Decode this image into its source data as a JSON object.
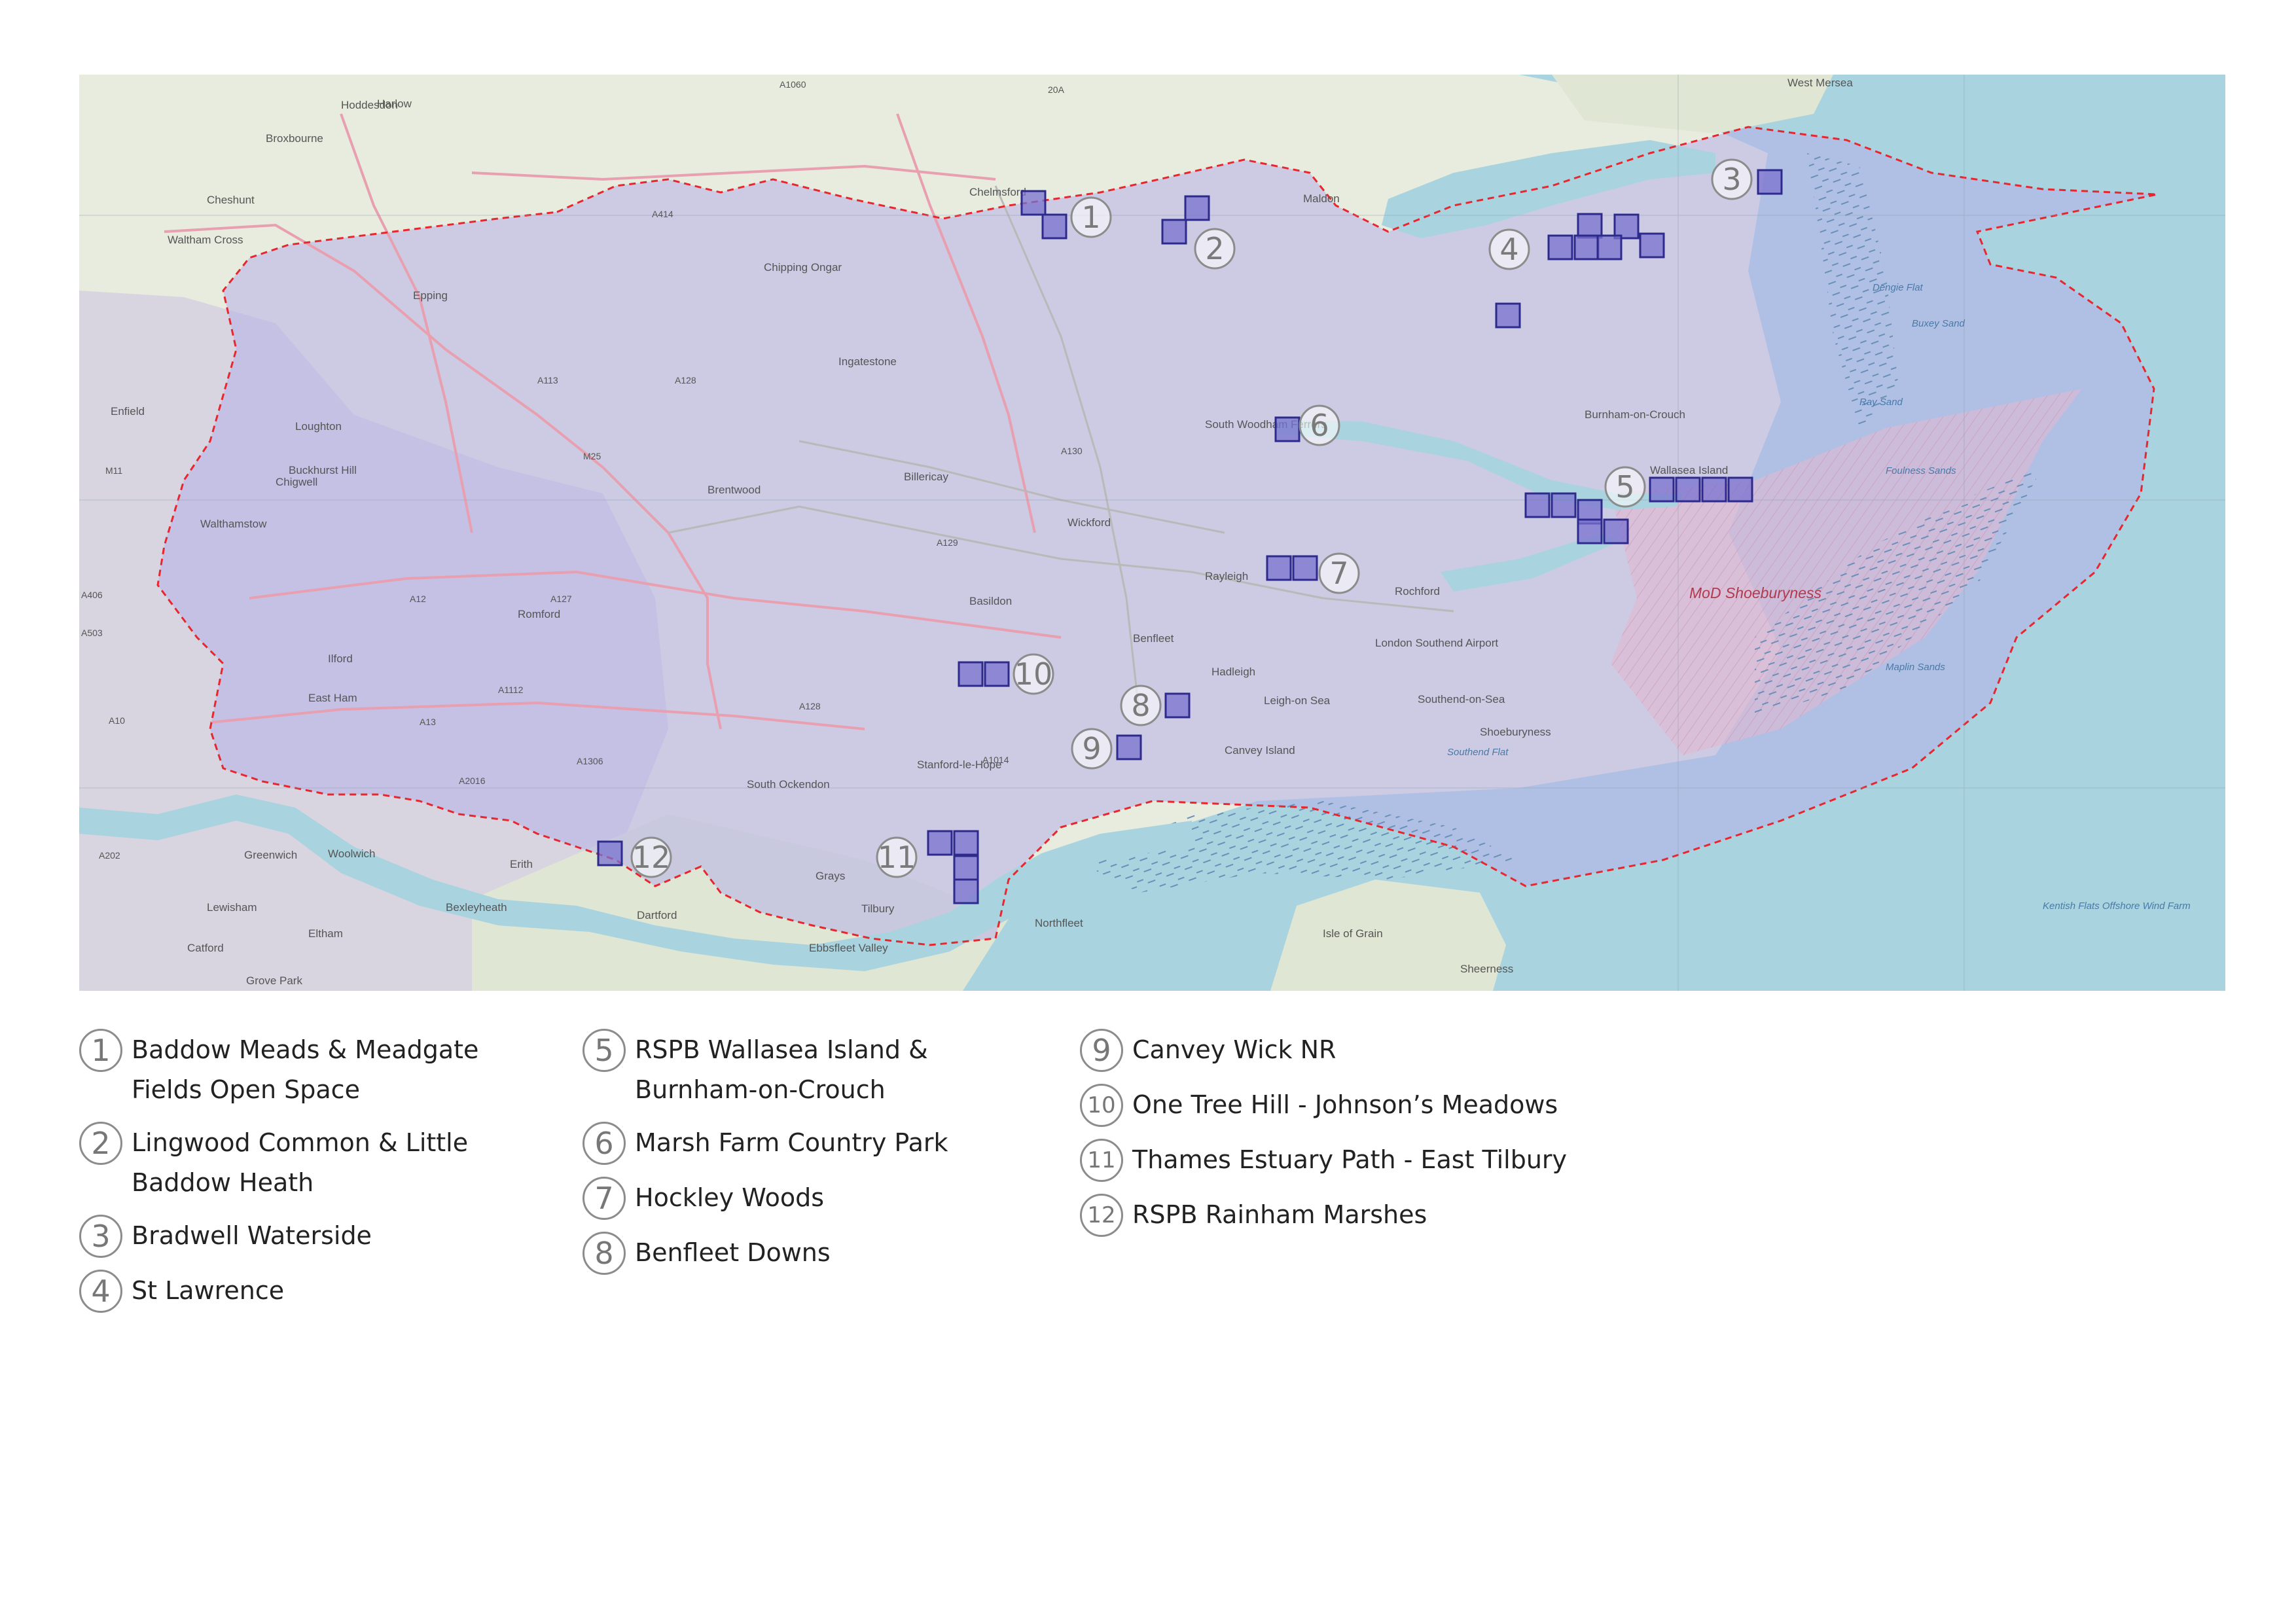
{
  "colors": {
    "land": "#e8ecde",
    "urban": "#d6d3e6",
    "sea": "#a9d3df",
    "region_fill": "#b4b1e8",
    "boundary": "#e8262d",
    "marker_fill": "#7a72cf",
    "marker_stroke": "#2d2a8c",
    "mod_area": "#e4b6cf"
  },
  "map": {
    "places": [
      {
        "name": "Hoddesdon"
      },
      {
        "name": "Harlow"
      },
      {
        "name": "Broxbourne"
      },
      {
        "name": "Cheshunt"
      },
      {
        "name": "Waltham Cross"
      },
      {
        "name": "Epping"
      },
      {
        "name": "Chipping Ongar"
      },
      {
        "name": "Enfield"
      },
      {
        "name": "Loughton"
      },
      {
        "name": "Buckhurst Hill"
      },
      {
        "name": "Chigwell"
      },
      {
        "name": "Walthamstow"
      },
      {
        "name": "Ilford"
      },
      {
        "name": "Romford"
      },
      {
        "name": "East Ham"
      },
      {
        "name": "Brentwood"
      },
      {
        "name": "Ingatestone"
      },
      {
        "name": "Chelmsford"
      },
      {
        "name": "Maldon"
      },
      {
        "name": "West Mersea"
      },
      {
        "name": "Billericay"
      },
      {
        "name": "Wickford"
      },
      {
        "name": "Basildon"
      },
      {
        "name": "Rayleigh"
      },
      {
        "name": "Rochford"
      },
      {
        "name": "South Woodham Ferrers"
      },
      {
        "name": "Burnham-on-Crouch"
      },
      {
        "name": "Wallasea Island"
      },
      {
        "name": "Benfleet"
      },
      {
        "name": "Hadleigh"
      },
      {
        "name": "Leigh-on Sea"
      },
      {
        "name": "Southend-on-Sea"
      },
      {
        "name": "Shoeburyness"
      },
      {
        "name": "Canvey Island"
      },
      {
        "name": "Stanford-le-Hope"
      },
      {
        "name": "South Ockendon"
      },
      {
        "name": "Grays"
      },
      {
        "name": "Tilbury"
      },
      {
        "name": "Erith"
      },
      {
        "name": "Dartford"
      },
      {
        "name": "Greenwich"
      },
      {
        "name": "Woolwich"
      },
      {
        "name": "Lewisham"
      },
      {
        "name": "Bexleyheath"
      },
      {
        "name": "Eltham"
      },
      {
        "name": "Catford"
      },
      {
        "name": "Grove Park"
      },
      {
        "name": "Northfleet"
      },
      {
        "name": "Ebbsfleet Valley"
      },
      {
        "name": "Isle of Grain"
      },
      {
        "name": "Sheerness"
      },
      {
        "name": "London Southend Airport"
      }
    ],
    "roads": [
      "A1060",
      "A414",
      "A113",
      "A128",
      "M25",
      "A130",
      "A129",
      "A12",
      "A127",
      "A1112",
      "A13",
      "A406",
      "A503",
      "A10",
      "A2016",
      "A1306",
      "A1014",
      "A202",
      "A128",
      "20A",
      "M11"
    ],
    "sea_labels": [
      "Dengie Flat",
      "Buxey Sand",
      "Ray Sand",
      "Foulness Sands",
      "Maplin Sands",
      "Southend Flat",
      "Kentish Flats Offshore Wind Farm"
    ],
    "restricted_area": "MoD Shoeburyness",
    "markers": [
      {
        "number": "1"
      },
      {
        "number": "2"
      },
      {
        "number": "3"
      },
      {
        "number": "4"
      },
      {
        "number": "5"
      },
      {
        "number": "6"
      },
      {
        "number": "7"
      },
      {
        "number": "8"
      },
      {
        "number": "9"
      },
      {
        "number": "10"
      },
      {
        "number": "11"
      },
      {
        "number": "12"
      }
    ]
  },
  "legend": [
    {
      "number": "1",
      "label": "Baddow Meads & Meadgate Fields Open Space"
    },
    {
      "number": "2",
      "label": "Lingwood Common & Little Baddow Heath"
    },
    {
      "number": "3",
      "label": "Bradwell Waterside"
    },
    {
      "number": "4",
      "label": "St Lawrence"
    },
    {
      "number": "5",
      "label": "RSPB Wallasea Island & Burnham-on-Crouch"
    },
    {
      "number": "6",
      "label": "Marsh Farm Country Park"
    },
    {
      "number": "7",
      "label": "Hockley Woods"
    },
    {
      "number": "8",
      "label": "Benfleet Downs"
    },
    {
      "number": "9",
      "label": "Canvey Wick NR"
    },
    {
      "number": "10",
      "label": "One Tree Hill - Johnson’s Meadows"
    },
    {
      "number": "11",
      "label": "Thames Estuary Path - East Tilbury"
    },
    {
      "number": "12",
      "label": "RSPB Rainham Marshes"
    }
  ]
}
